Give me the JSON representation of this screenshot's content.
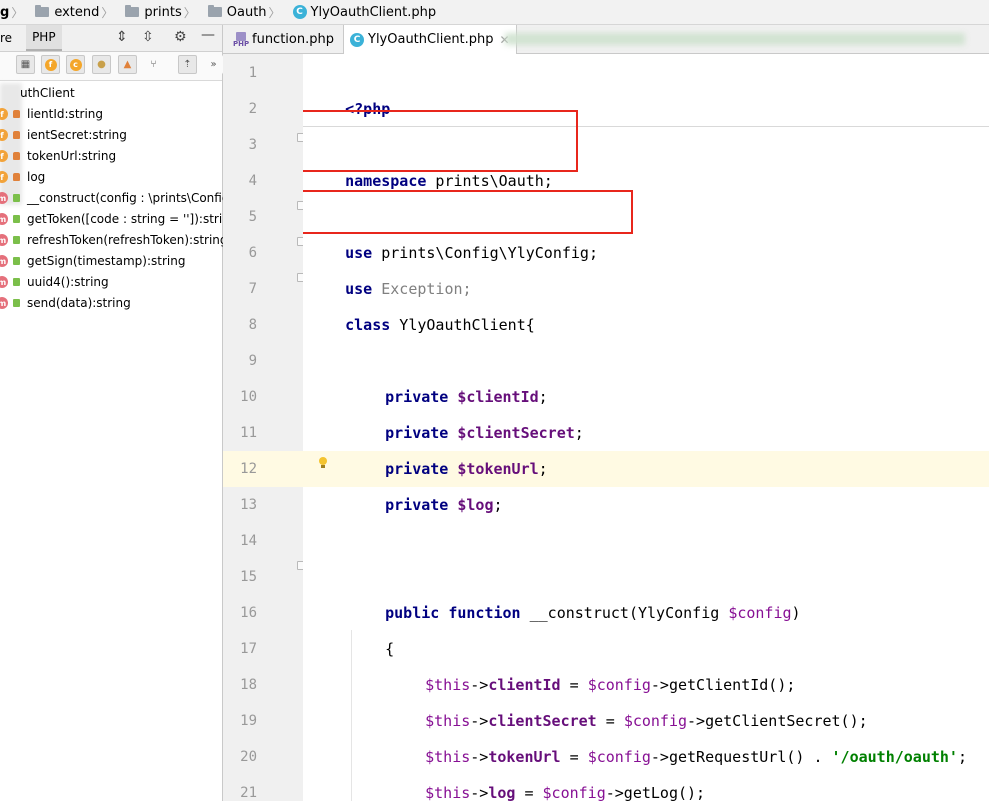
{
  "breadcrumb": {
    "root": "g",
    "items": [
      "extend",
      "prints",
      "Oauth"
    ],
    "file": "YlyOauthClient.php",
    "file_icon": "C"
  },
  "left_panel": {
    "tabs": [
      "re",
      "PHP"
    ],
    "active_tab": "PHP",
    "toolbar_buttons": [
      "add-field",
      "field",
      "class",
      "constant",
      "private",
      "merge",
      "autoscroll",
      "more"
    ],
    "class_name": "uthClient",
    "members": [
      {
        "kind": "field",
        "visibility": "private",
        "label": "lientId:string"
      },
      {
        "kind": "field",
        "visibility": "private",
        "label": "ientSecret:string"
      },
      {
        "kind": "field",
        "visibility": "private",
        "label": "tokenUrl:string"
      },
      {
        "kind": "field",
        "visibility": "private",
        "label": "log"
      },
      {
        "kind": "method",
        "visibility": "public",
        "label": "__construct(config : \\prints\\Config"
      },
      {
        "kind": "method",
        "visibility": "public",
        "label": "getToken([code : string = '']):strin"
      },
      {
        "kind": "method",
        "visibility": "public",
        "label": "refreshToken(refreshToken):string"
      },
      {
        "kind": "method",
        "visibility": "public",
        "label": "getSign(timestamp):string"
      },
      {
        "kind": "method",
        "visibility": "public",
        "label": "uuid4():string"
      },
      {
        "kind": "method",
        "visibility": "public",
        "label": "send(data):string"
      }
    ]
  },
  "editor": {
    "tabs": [
      {
        "label": "function.php",
        "icon": "php-file-icon",
        "active": false
      },
      {
        "label": "YlyOauthClient.php",
        "icon": "class-file-icon",
        "active": true
      }
    ],
    "highlighted_line": 12,
    "line_numbers": [
      "1",
      "2",
      "3",
      "4",
      "5",
      "6",
      "7",
      "8",
      "9",
      "10",
      "11",
      "12",
      "13",
      "14",
      "15",
      "16",
      "17",
      "18",
      "19",
      "20",
      "21"
    ],
    "code": {
      "l1": "<?php",
      "l3_kw": "namespace",
      "l3_rest": " prints\\Oauth;",
      "l5_kw": "use",
      "l5_rest": " prints\\Config\\YlyConfig;",
      "l6_kw": "use",
      "l6_rest": " Exception;",
      "l7_kw": "class",
      "l7_rest": " YlyOauthClient{",
      "private": "private",
      "l9_var": "$clientId",
      "l10_var": "$clientSecret",
      "l11_var": "$tokenUrl",
      "l12_var": "$log",
      "semicolon": ";",
      "l15_kw1": "public",
      "l15_kw2": "function",
      "l15_name": " __construct(YlyConfig ",
      "l15_var": "$config",
      "l15_end": ")",
      "l16": "{",
      "this": "$this",
      "arrow": "->",
      "l17_prop": "clientId",
      "l17_mid": " = ",
      "config": "$config",
      "l17_call": "->getClientId();",
      "l18_prop": "clientSecret",
      "l18_call": "->getClientSecret();",
      "l19_prop": "tokenUrl",
      "l19_call": "->getRequestUrl() . ",
      "l19_str": "'/oauth/oauth'",
      "l19_end": ";",
      "l20_prop": "log",
      "l20_call": "->getLog();",
      "l21": "}"
    }
  },
  "colors": {
    "annotation_box": "#e8261c",
    "keyword": "#000080",
    "field": "#660e7a",
    "string": "#008000",
    "current_line": "#fffae3"
  }
}
